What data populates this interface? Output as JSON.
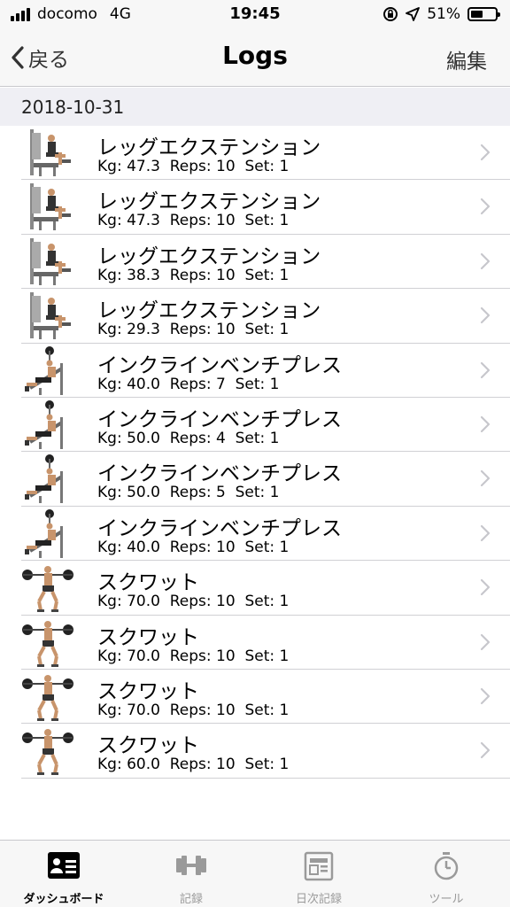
{
  "status_bar": {
    "carrier": "docomo",
    "network": "4G",
    "time": "19:45",
    "battery_text": "51%",
    "battery_level": 0.51
  },
  "nav": {
    "back_label": "戻る",
    "title": "Logs",
    "edit_label": "編集"
  },
  "section": {
    "date": "2018-10-31"
  },
  "logs": [
    {
      "name": "レッグエクステンション",
      "detail": "Kg: 47.3  Reps: 10  Set: 1",
      "icon": "leg-extension-image"
    },
    {
      "name": "レッグエクステンション",
      "detail": "Kg: 47.3  Reps: 10  Set: 1",
      "icon": "leg-extension-image"
    },
    {
      "name": "レッグエクステンション",
      "detail": "Kg: 38.3  Reps: 10  Set: 1",
      "icon": "leg-extension-image"
    },
    {
      "name": "レッグエクステンション",
      "detail": "Kg: 29.3  Reps: 10  Set: 1",
      "icon": "leg-extension-image"
    },
    {
      "name": "インクラインベンチプレス",
      "detail": "Kg: 40.0  Reps: 7  Set: 1",
      "icon": "incline-bench-press-image"
    },
    {
      "name": "インクラインベンチプレス",
      "detail": "Kg: 50.0  Reps: 4  Set: 1",
      "icon": "incline-bench-press-image"
    },
    {
      "name": "インクラインベンチプレス",
      "detail": "Kg: 50.0  Reps: 5  Set: 1",
      "icon": "incline-bench-press-image"
    },
    {
      "name": "インクラインベンチプレス",
      "detail": "Kg: 40.0  Reps: 10  Set: 1",
      "icon": "incline-bench-press-image"
    },
    {
      "name": "スクワット",
      "detail": "Kg: 70.0  Reps: 10  Set: 1",
      "icon": "squat-image"
    },
    {
      "name": "スクワット",
      "detail": "Kg: 70.0  Reps: 10  Set: 1",
      "icon": "squat-image"
    },
    {
      "name": "スクワット",
      "detail": "Kg: 70.0  Reps: 10  Set: 1",
      "icon": "squat-image"
    },
    {
      "name": "スクワット",
      "detail": "Kg: 60.0  Reps: 10  Set: 1",
      "icon": "squat-image"
    }
  ],
  "tabs": [
    {
      "label": "ダッシュボード",
      "icon": "dashboard-icon",
      "active": true
    },
    {
      "label": "記録",
      "icon": "dumbbell-icon",
      "active": false
    },
    {
      "label": "日次記録",
      "icon": "daily-log-icon",
      "active": false
    },
    {
      "label": "ツール",
      "icon": "stopwatch-icon",
      "active": false
    }
  ],
  "colors": {
    "bar_background": "#f7f7f7",
    "section_background": "#efeff4",
    "chevron": "#c7c7cc",
    "tab_inactive": "#9a9a9a"
  }
}
